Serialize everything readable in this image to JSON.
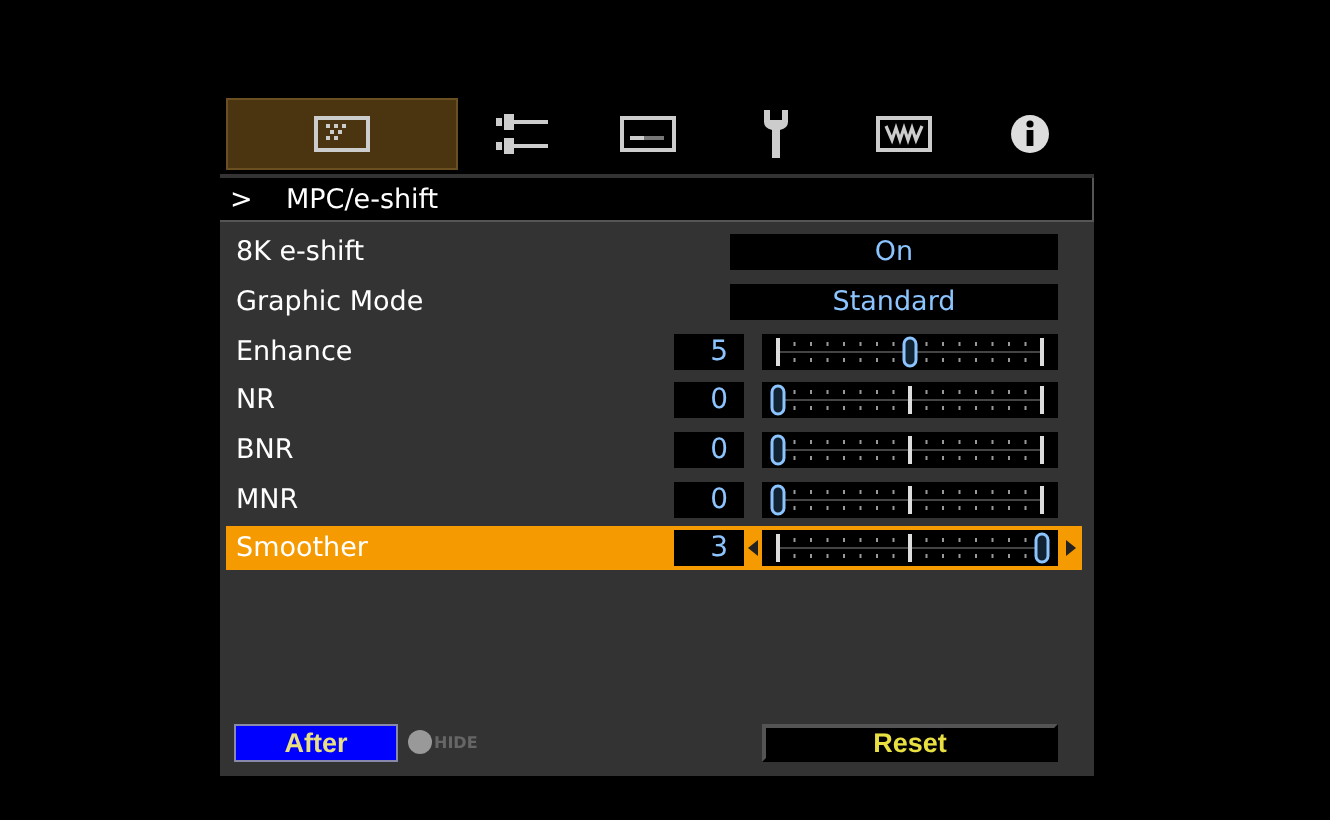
{
  "tabs": [
    {
      "kind": "picture",
      "selected": true
    },
    {
      "kind": "input",
      "selected": false
    },
    {
      "kind": "display",
      "selected": false
    },
    {
      "kind": "wrench",
      "selected": false
    },
    {
      "kind": "keyboard",
      "selected": false
    },
    {
      "kind": "info",
      "selected": false
    }
  ],
  "breadcrumb": {
    "marker": ">",
    "title": "MPC/e-shift"
  },
  "rows": [
    {
      "kind": "option",
      "label": "8K e-shift",
      "value": "On",
      "selected": false
    },
    {
      "kind": "option",
      "label": "Graphic Mode",
      "value": "Standard",
      "selected": false
    },
    {
      "kind": "slider",
      "label": "Enhance",
      "value": "5",
      "level": 0.5,
      "selected": false
    },
    {
      "kind": "slider",
      "label": "NR",
      "value": "0",
      "level": 0,
      "selected": false
    },
    {
      "kind": "slider",
      "label": "BNR",
      "value": "0",
      "level": 0,
      "selected": false
    },
    {
      "kind": "slider",
      "label": "MNR",
      "value": "0",
      "level": 0,
      "selected": false
    },
    {
      "kind": "slider",
      "label": "Smoother",
      "value": "3",
      "level": 1,
      "selected": true
    }
  ],
  "footer": {
    "mode_button": "After",
    "hide_label": "HIDE",
    "reset_button": "Reset"
  }
}
